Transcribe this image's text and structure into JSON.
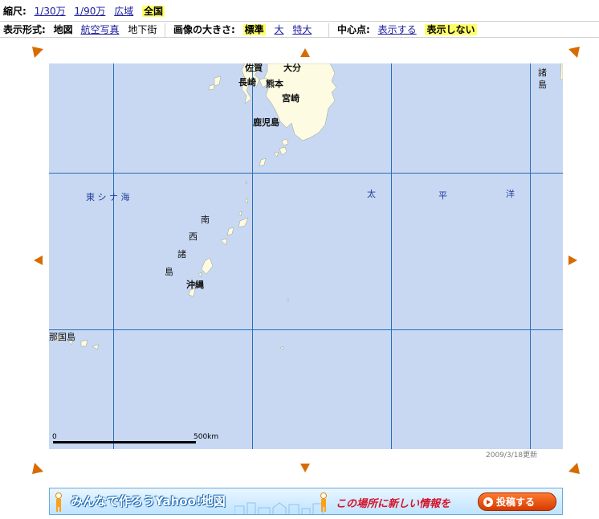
{
  "toolbar": {
    "scale_label": "縮尺:",
    "scale_options": [
      "1/30万",
      "1/90万",
      "広域"
    ],
    "scale_selected": "全国",
    "display_label": "表示形式:",
    "display_selected": "地図",
    "display_aerial": "航空写真",
    "display_underground": "地下街",
    "size_label": "画像の大きさ:",
    "size_selected": "標準",
    "size_large": "大",
    "size_xlarge": "特大",
    "center_label": "中心点:",
    "center_show": "表示する",
    "center_hide_selected": "表示しない"
  },
  "map": {
    "places": {
      "fukuoka_partial": "佐賀",
      "oita": "大分",
      "nagasaki": "長崎",
      "kumamoto": "熊本",
      "miyazaki": "宮崎",
      "kagoshima": "鹿児島",
      "okinawa": "沖縄",
      "ogasawara_1": "諸",
      "ogasawara_2": "島",
      "yonaguni": "那国島",
      "nansei_1": "南",
      "nansei_2": "西",
      "nansei_3": "諸",
      "nansei_4": "島"
    },
    "seas": {
      "east_china_sea": "東 シ ナ 海",
      "pacific_1": "太",
      "pacific_2": "平",
      "pacific_3": "洋"
    },
    "scale_bar": {
      "start": "0",
      "end": "500km"
    },
    "updated": "2009/3/18更新",
    "colors": {
      "sea": "#c8d8f2",
      "land": "#fdfbe2",
      "grid": "#2870b8",
      "arrow": "#d76b00"
    }
  },
  "banner": {
    "headline": "みんなで作ろうYahoo!地図",
    "message": "この場所に新しい情報を",
    "button": "投稿する"
  }
}
